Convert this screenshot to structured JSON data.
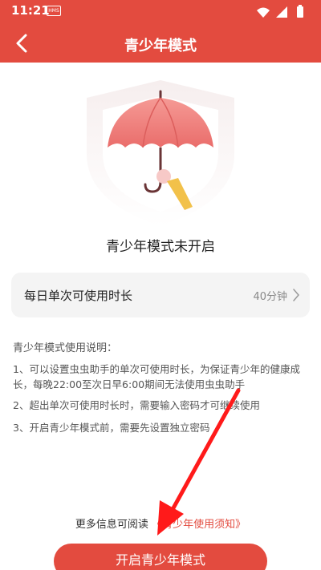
{
  "status_bar": {
    "time": "11:21",
    "badge": "HMS",
    "icons": [
      "wifi-icon",
      "signal-icon",
      "battery-icon"
    ]
  },
  "header": {
    "title": "青少年模式",
    "back_icon": "chevron-left-icon"
  },
  "illustration": {
    "icons": [
      "shield-icon",
      "umbrella-icon"
    ]
  },
  "mode_status": "青少年模式未开启",
  "duration": {
    "label": "每日单次可使用时长",
    "value": "40分钟"
  },
  "instructions": {
    "title": "青少年模式使用说明：",
    "items": [
      "1、可以设置虫虫助手的单次可使用时长，为保证青少年的健康成长，每晚22:00至次日早6:00期间无法使用虫虫助手",
      "2、超出单次可使用时长时，需要输入密码才可继续使用",
      "3、开启青少年模式前，需要先设置独立密码"
    ]
  },
  "footer": {
    "more_info_text": "更多信息可阅读",
    "more_info_link": "《青少年使用须知》",
    "enable_button": "开启青少年模式"
  },
  "colors": {
    "brand": "#e34b3f",
    "card_bg": "#f4f4f4",
    "umbrella": "#f08080",
    "annotation_arrow": "#ff1a1a"
  }
}
